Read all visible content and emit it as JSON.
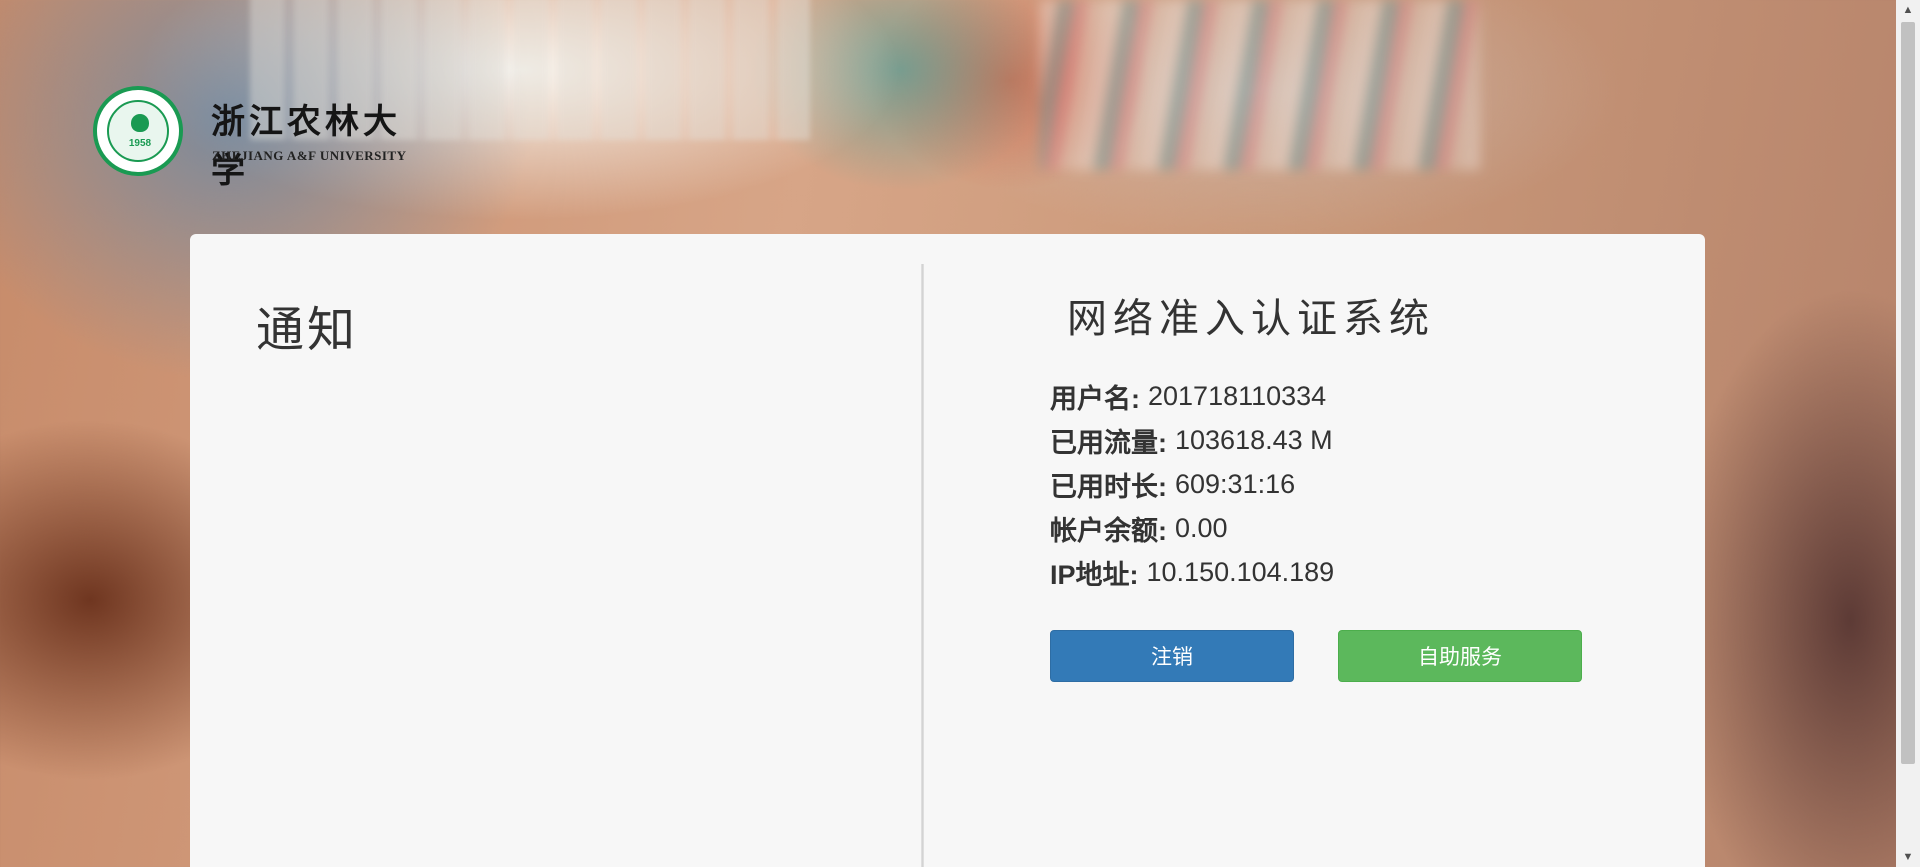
{
  "logo": {
    "name_cn": "浙江农林大学",
    "name_en": "ZHEJIANG A&F UNIVERSITY",
    "year": "1958"
  },
  "notice": {
    "title": "通知"
  },
  "system": {
    "title": "网络准入认证系统"
  },
  "account": {
    "username_label": "用户名:",
    "username": "201718110334",
    "traffic_label": "已用流量:",
    "traffic": "103618.43 M",
    "duration_label": "已用时长:",
    "duration": "609:31:16",
    "balance_label": "帐户余额:",
    "balance": "0.00",
    "ip_label": "IP地址:",
    "ip": "10.150.104.189"
  },
  "buttons": {
    "logout": "注销",
    "self_service": "自助服务"
  },
  "colors": {
    "primary": "#337ab7",
    "success": "#5cb85c",
    "panel": "#f7f7f7"
  }
}
